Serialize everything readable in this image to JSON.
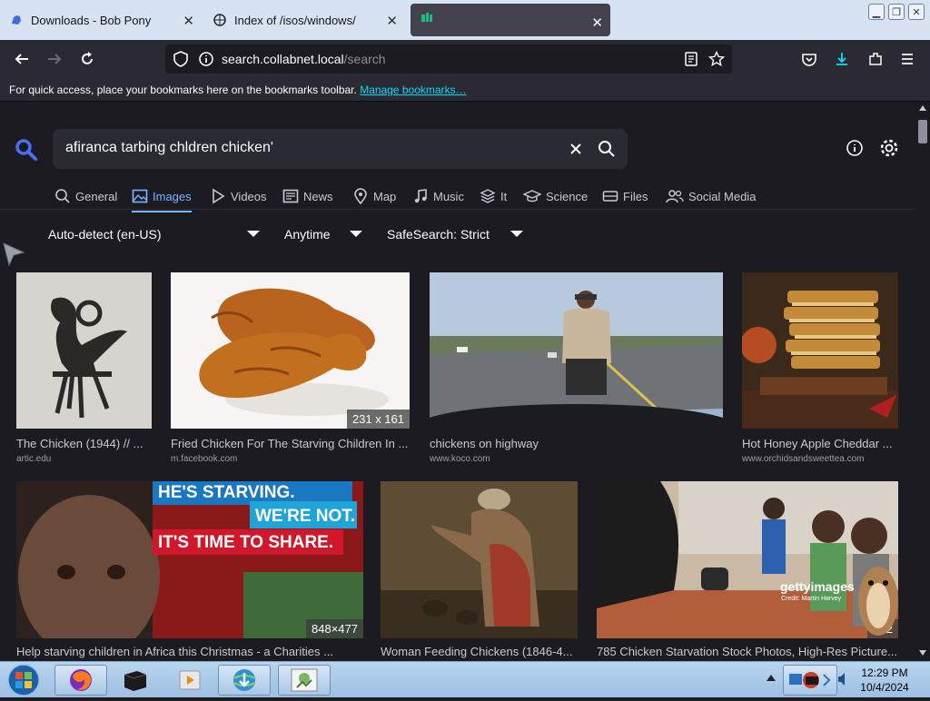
{
  "browser": {
    "tabs": [
      {
        "title": "Downloads - Bob Pony",
        "active": false
      },
      {
        "title": "Index of /isos/windows/",
        "active": false
      },
      {
        "title": "",
        "active": true
      }
    ],
    "url": {
      "host": "search.collabnet.local",
      "path": "/search"
    },
    "bookmarks_bar": {
      "message": "For quick access, place your bookmarks here on the bookmarks toolbar.",
      "link": "Manage bookmarks…"
    }
  },
  "search": {
    "query": "afiranca tarbing chldren chicken'",
    "categories": [
      {
        "label": "General",
        "icon": "search-icon",
        "active": false
      },
      {
        "label": "Images",
        "icon": "image-icon",
        "active": true
      },
      {
        "label": "Videos",
        "icon": "play-icon",
        "active": false
      },
      {
        "label": "News",
        "icon": "newspaper-icon",
        "active": false
      },
      {
        "label": "Map",
        "icon": "map-pin-icon",
        "active": false
      },
      {
        "label": "Music",
        "icon": "music-note-icon",
        "active": false
      },
      {
        "label": "It",
        "icon": "layers-icon",
        "active": false
      },
      {
        "label": "Science",
        "icon": "graduation-cap-icon",
        "active": false
      },
      {
        "label": "Files",
        "icon": "drive-icon",
        "active": false
      },
      {
        "label": "Social Media",
        "icon": "people-icon",
        "active": false
      }
    ],
    "filters": {
      "language": "Auto-detect (en-US)",
      "time": "Anytime",
      "safesearch": "SafeSearch: Strict"
    }
  },
  "results": [
    {
      "caption": "The Chicken (1944) // ...",
      "source": "artic.edu",
      "dims": ""
    },
    {
      "caption": "Fried Chicken For The Starving Children In ...",
      "source": "m.facebook.com",
      "dims": "231 x 161"
    },
    {
      "caption": "chickens on highway",
      "source": "www.koco.com",
      "dims": ""
    },
    {
      "caption": "Hot Honey Apple Cheddar ...",
      "source": "www.orchidsandsweettea.com",
      "dims": ""
    },
    {
      "caption": "Help starving children in Africa this Christmas - a Charities ...",
      "source": "",
      "dims": "848×477",
      "overlay": [
        "HE'S STARVING.",
        "WE'RE NOT.",
        "IT'S TIME TO SHARE."
      ]
    },
    {
      "caption": "Woman Feeding Chickens (1846-4...",
      "source": "",
      "dims": ""
    },
    {
      "caption": "785 Chicken Starvation Stock Photos, High-Res Picture...",
      "source": "",
      "dims": "612",
      "watermark": "gettyimages",
      "credit": "Credit: Martin Harvey"
    }
  ],
  "taskbar": {
    "time": "12:29 PM",
    "date": "10/4/2024"
  },
  "colors": {
    "accent": "#7db3ff",
    "page_bg": "#1c1b22",
    "toolbar": "#2b2a33",
    "tabstrip": "#d7e3f3"
  }
}
